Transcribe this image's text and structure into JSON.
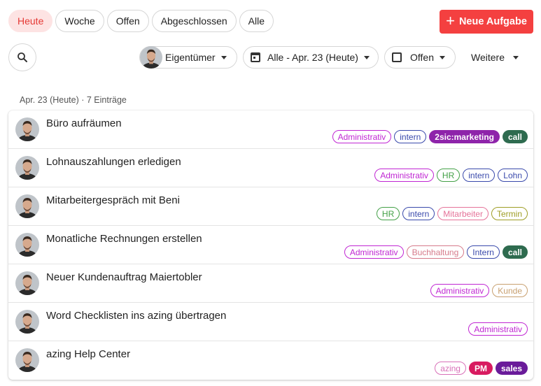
{
  "tabs": [
    {
      "label": "Heute",
      "active": true
    },
    {
      "label": "Woche"
    },
    {
      "label": "Offen"
    },
    {
      "label": "Abgeschlossen"
    },
    {
      "label": "Alle"
    }
  ],
  "new_task_button": {
    "label": "Neue Aufgabe",
    "icon": "plus-icon"
  },
  "filters": {
    "owner": "Eigentümer",
    "date": "Alle - Apr. 23 (Heute)",
    "status": "Offen",
    "more": "Weitere"
  },
  "section": {
    "header": "Apr. 23 (Heute) · 7 Einträge"
  },
  "tag_colors": {
    "Administrativ": {
      "color": "#c026d3",
      "filled": false
    },
    "intern": {
      "color": "#3949ab",
      "filled": false
    },
    "Intern": {
      "color": "#3949ab",
      "filled": false
    },
    "2sic:marketing": {
      "color": "#8e24aa",
      "filled": true
    },
    "call": {
      "color": "#2e6b4f",
      "filled": true
    },
    "HR": {
      "color": "#43a047",
      "filled": false
    },
    "Lohn": {
      "color": "#3949ab",
      "filled": false
    },
    "Mitarbeiter": {
      "color": "#e57399",
      "filled": false
    },
    "Termin": {
      "color": "#9e9d24",
      "filled": false
    },
    "Buchhaltung": {
      "color": "#d67a8a",
      "filled": false
    },
    "Kunde": {
      "color": "#c8a070",
      "filled": false
    },
    "azing": {
      "color": "#d870b8",
      "filled": false
    },
    "PM": {
      "color": "#d81b60",
      "filled": true
    },
    "sales": {
      "color": "#6a1b9a",
      "filled": true
    }
  },
  "tasks": [
    {
      "title": "Büro aufräumen",
      "tags": [
        "Administrativ",
        "intern",
        "2sic:marketing",
        "call"
      ]
    },
    {
      "title": "Lohnauszahlungen erledigen",
      "tags": [
        "Administrativ",
        "HR",
        "intern",
        "Lohn"
      ]
    },
    {
      "title": "Mitarbeitergespräch mit Beni",
      "tags": [
        "HR",
        "intern",
        "Mitarbeiter",
        "Termin"
      ]
    },
    {
      "title": "Monatliche Rechnungen erstellen",
      "tags": [
        "Administrativ",
        "Buchhaltung",
        "Intern",
        "call"
      ]
    },
    {
      "title": "Neuer Kundenauftrag Maiertobler",
      "tags": [
        "Administrativ",
        "Kunde"
      ]
    },
    {
      "title": "Word Checklisten ins azing übertragen",
      "tags": [
        "Administrativ"
      ]
    },
    {
      "title": "azing Help Center",
      "tags": [
        "azing",
        "PM",
        "sales"
      ]
    }
  ]
}
